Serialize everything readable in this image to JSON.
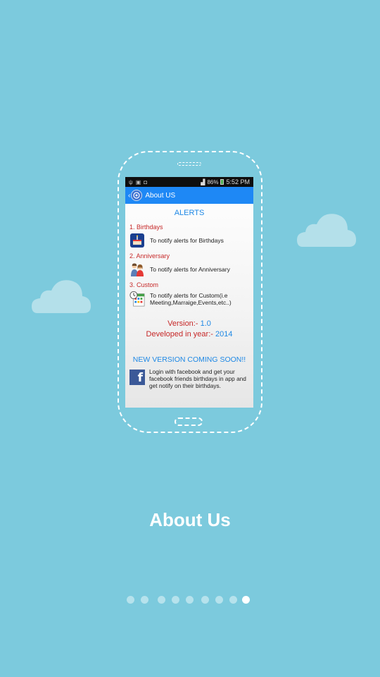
{
  "screen": {
    "statusbar": {
      "battery": "86%",
      "time": "5:52 PM"
    },
    "actionbar": {
      "back": "‹",
      "title": "About US"
    },
    "heading": "ALERTS",
    "items": [
      {
        "title": "1. Birthdays",
        "text": "To notify alerts for Birthdays",
        "icon": "birthday-cake-icon"
      },
      {
        "title": "2. Anniversary",
        "text": "To notify alerts for Anniversary",
        "icon": "couple-icon"
      },
      {
        "title": "3. Custom",
        "text": "To notify alerts for Custom(i.e Meeting,Marraige,Events,etc..)",
        "icon": "calendar-clock-icon"
      }
    ],
    "version_label": "Version:-",
    "version_value": "1.0",
    "year_label": "Developed in year:-",
    "year_value": "2014",
    "new_version": "NEW VERSION COMING SOON!!",
    "fb_text": "Login with facebook and get your facebook friends birthdays in app and get notify on their birthdays.",
    "fb_icon_letter": "f"
  },
  "page_title": "About Us",
  "pager": {
    "count": 9,
    "active_index": 8
  },
  "colors": {
    "background": "#7ccadd",
    "actionbar": "#1e88f5",
    "accent_blue": "#1e88e5",
    "accent_red": "#c62828",
    "facebook": "#3b5998"
  }
}
